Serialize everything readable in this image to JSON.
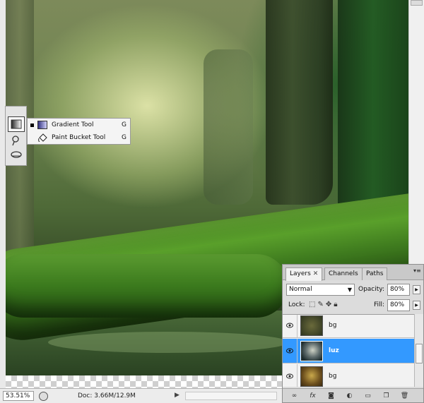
{
  "status_bar": {
    "zoom": "53.51%",
    "doc_info": "Doc: 3.66M/12.9M"
  },
  "tool_flyout": {
    "items": [
      {
        "label": "Gradient Tool",
        "shortcut": "G",
        "active": true
      },
      {
        "label": "Paint Bucket Tool",
        "shortcut": "G",
        "active": false
      }
    ]
  },
  "layers_panel": {
    "tabs": [
      {
        "label": "Layers",
        "close": "✕",
        "active": true
      },
      {
        "label": "Channels",
        "active": false
      },
      {
        "label": "Paths",
        "active": false
      }
    ],
    "blend_mode": "Normal",
    "opacity_label": "Opacity:",
    "opacity_value": "80%",
    "lock_label": "Lock:",
    "fill_label": "Fill:",
    "fill_value": "80%",
    "layers": [
      {
        "name": "bg",
        "selected": false,
        "visible": true
      },
      {
        "name": "luz",
        "selected": true,
        "visible": true
      },
      {
        "name": "bg",
        "selected": false,
        "visible": true
      }
    ],
    "footer_icons": [
      "link-icon",
      "fx-icon",
      "mask-icon",
      "adjustment-icon",
      "folder-icon",
      "new-layer-icon",
      "trash-icon"
    ]
  },
  "colors": {
    "selection": "#3399ff",
    "panel": "#dcdcdc"
  }
}
